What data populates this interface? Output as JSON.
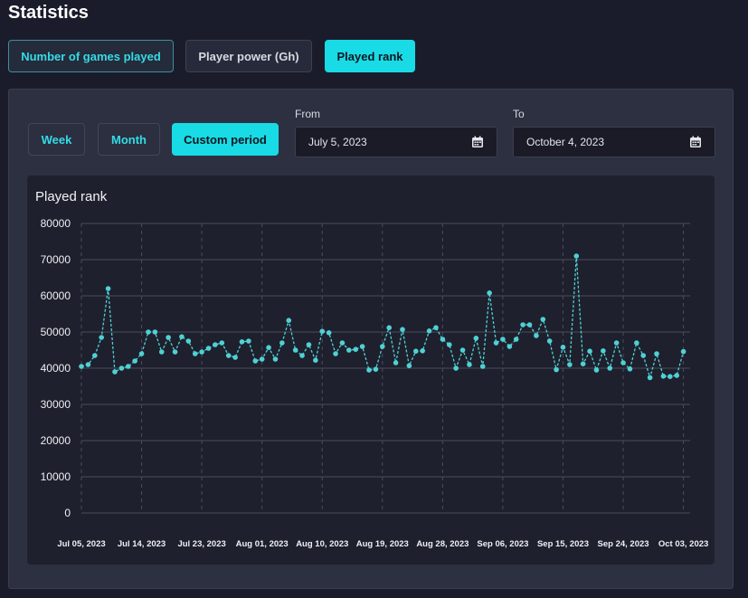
{
  "header": {
    "title": "Statistics"
  },
  "tabs": [
    {
      "label": "Number of games played"
    },
    {
      "label": "Player power (Gh)"
    },
    {
      "label": "Played rank"
    }
  ],
  "period": {
    "buttons": [
      {
        "label": "Week"
      },
      {
        "label": "Month"
      },
      {
        "label": "Custom period"
      }
    ],
    "from_label": "From",
    "from_value": "July 5, 2023",
    "to_label": "To",
    "to_value": "October 4, 2023"
  },
  "chart_data": {
    "type": "line",
    "title": "Played rank",
    "ylim": [
      0,
      80000
    ],
    "y_ticks": [
      "80000",
      "70000",
      "60000",
      "50000",
      "40000",
      "30000",
      "20000",
      "10000",
      "0"
    ],
    "x_ticks": [
      "Jul 05, 2023",
      "Jul 14, 2023",
      "Jul 23, 2023",
      "Aug 01, 2023",
      "Aug 10, 2023",
      "Aug 19, 2023",
      "Aug 28, 2023",
      "Sep 06, 2023",
      "Sep 15, 2023",
      "Sep 24, 2023",
      "Oct 03, 2023"
    ],
    "x_start": "Jul 05, 2023",
    "x_end": "Oct 04, 2023",
    "grid": true,
    "series": [
      {
        "color": "#4fd1d4",
        "values": [
          40500,
          41000,
          43500,
          48500,
          62000,
          39000,
          40000,
          40500,
          42000,
          44000,
          50000,
          50000,
          44500,
          48500,
          44500,
          48700,
          47500,
          44000,
          44500,
          45500,
          46500,
          47000,
          43500,
          43000,
          47300,
          47500,
          42000,
          42500,
          45700,
          42500,
          47000,
          53200,
          45000,
          43500,
          46500,
          42200,
          50200,
          49800,
          44000,
          47000,
          45000,
          45200,
          46000,
          39500,
          39700,
          46000,
          51200,
          41500,
          50700,
          40700,
          44700,
          44800,
          50300,
          51200,
          48000,
          46500,
          40000,
          45000,
          41000,
          48300,
          40500,
          60800,
          47000,
          48000,
          46000,
          48000,
          52000,
          52000,
          49000,
          53500,
          47500,
          39600,
          45800,
          41000,
          71000,
          41200,
          44700,
          39500,
          44800,
          40000,
          47000,
          41500,
          39800,
          47000,
          43500,
          37400,
          44000,
          37800,
          37700,
          38000,
          44600
        ]
      }
    ]
  }
}
